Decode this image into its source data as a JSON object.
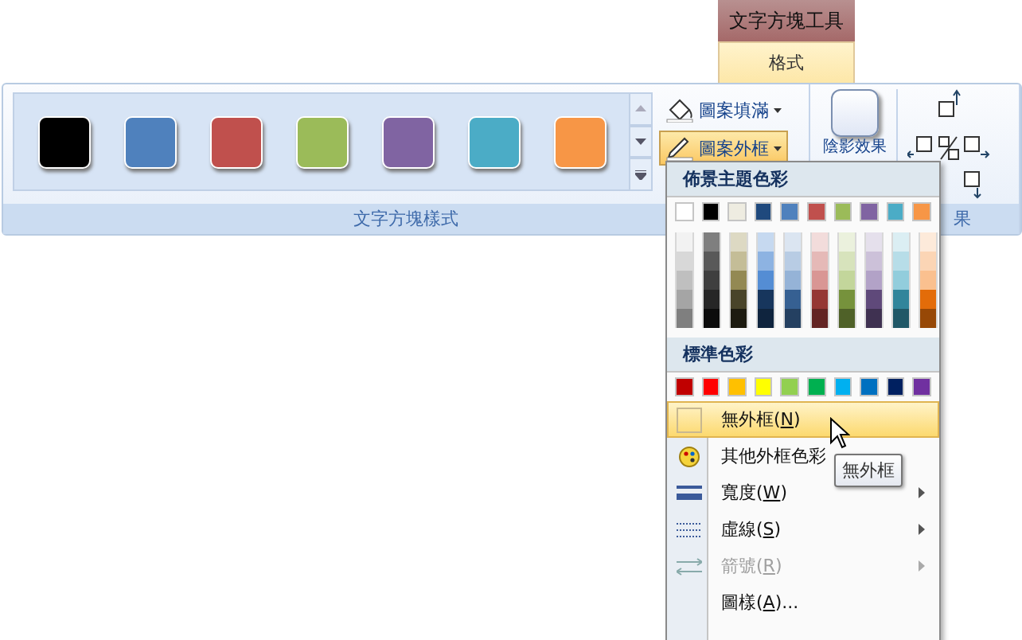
{
  "context_tab": {
    "title": "文字方塊工具",
    "tab": {
      "label": "格式",
      "selected": true
    }
  },
  "style_group": {
    "label": "文字方塊樣式",
    "swatches": [
      {
        "color": "#000000"
      },
      {
        "color": "#4f81bd"
      },
      {
        "color": "#c0504d"
      },
      {
        "color": "#9bbb59"
      },
      {
        "color": "#8064a2"
      },
      {
        "color": "#4bacc6"
      },
      {
        "color": "#f79646"
      }
    ],
    "fill_button": {
      "label": "圖案填滿"
    },
    "outline_button": {
      "label": "圖案外框",
      "expanded": true
    }
  },
  "shadow_group": {
    "button_label": "陰影效果",
    "group_label_visible": "果"
  },
  "outline_menu": {
    "theme_header": "佈景主題色彩",
    "theme_colors": [
      {
        "color": "#ffffff",
        "shades": [
          {
            "color": "#f2f2f2"
          },
          {
            "color": "#d8d8d8"
          },
          {
            "color": "#bfbfbf"
          },
          {
            "color": "#a5a5a5"
          },
          {
            "color": "#7f7f7f"
          }
        ]
      },
      {
        "color": "#000000",
        "shades": [
          {
            "color": "#7f7f7f"
          },
          {
            "color": "#595959"
          },
          {
            "color": "#3f3f3f"
          },
          {
            "color": "#262626"
          },
          {
            "color": "#0c0c0c"
          }
        ]
      },
      {
        "color": "#eeece1",
        "shades": [
          {
            "color": "#ddd9c3"
          },
          {
            "color": "#c4bd97"
          },
          {
            "color": "#938953"
          },
          {
            "color": "#494429"
          },
          {
            "color": "#1d1b10"
          }
        ]
      },
      {
        "color": "#1f497d",
        "shades": [
          {
            "color": "#c6d9f0"
          },
          {
            "color": "#8db3e2"
          },
          {
            "color": "#548dd4"
          },
          {
            "color": "#17365d"
          },
          {
            "color": "#0f243e"
          }
        ]
      },
      {
        "color": "#4f81bd",
        "shades": [
          {
            "color": "#dbe5f1"
          },
          {
            "color": "#b8cce4"
          },
          {
            "color": "#95b3d7"
          },
          {
            "color": "#366092"
          },
          {
            "color": "#244061"
          }
        ]
      },
      {
        "color": "#c0504d",
        "shades": [
          {
            "color": "#f2dcdb"
          },
          {
            "color": "#e5b9b7"
          },
          {
            "color": "#d99694"
          },
          {
            "color": "#953734"
          },
          {
            "color": "#632423"
          }
        ]
      },
      {
        "color": "#9bbb59",
        "shades": [
          {
            "color": "#ebf1dd"
          },
          {
            "color": "#d7e3bc"
          },
          {
            "color": "#c3d69b"
          },
          {
            "color": "#76923c"
          },
          {
            "color": "#4f6128"
          }
        ]
      },
      {
        "color": "#8064a2",
        "shades": [
          {
            "color": "#e5e0ec"
          },
          {
            "color": "#ccc1d9"
          },
          {
            "color": "#b2a2c7"
          },
          {
            "color": "#5f497a"
          },
          {
            "color": "#3f3151"
          }
        ]
      },
      {
        "color": "#4bacc6",
        "shades": [
          {
            "color": "#dbeef3"
          },
          {
            "color": "#b7dde8"
          },
          {
            "color": "#92cddc"
          },
          {
            "color": "#31859b"
          },
          {
            "color": "#205867"
          }
        ]
      },
      {
        "color": "#f79646",
        "shades": [
          {
            "color": "#fdeada"
          },
          {
            "color": "#fbd5b5"
          },
          {
            "color": "#fac08f"
          },
          {
            "color": "#e36c09"
          },
          {
            "color": "#974806"
          }
        ]
      }
    ],
    "standard_header": "標準色彩",
    "standard_colors": [
      {
        "color": "#c00000"
      },
      {
        "color": "#ff0000"
      },
      {
        "color": "#ffc000"
      },
      {
        "color": "#ffff00"
      },
      {
        "color": "#92d050"
      },
      {
        "color": "#00b050"
      },
      {
        "color": "#00b0f0"
      },
      {
        "color": "#0070c0"
      },
      {
        "color": "#002060"
      },
      {
        "color": "#7030a0"
      }
    ],
    "items": [
      {
        "kind": "none",
        "text": "無外框(",
        "accel": "N",
        "tail": ")",
        "selected": true,
        "disabled": false,
        "submenu": false
      },
      {
        "kind": "colors",
        "text": "其他外框色彩",
        "selected": false,
        "disabled": false,
        "submenu": false
      },
      {
        "kind": "weight",
        "text": "寬度(",
        "accel": "W",
        "tail": ")",
        "selected": false,
        "disabled": false,
        "submenu": true
      },
      {
        "kind": "dashes",
        "text": "虛線(",
        "accel": "S",
        "tail": ")",
        "selected": false,
        "disabled": false,
        "submenu": true
      },
      {
        "kind": "arrows",
        "text": "箭號(",
        "accel": "R",
        "tail": ")",
        "selected": false,
        "disabled": true,
        "submenu": true
      },
      {
        "kind": "pattern",
        "text": "圖樣(",
        "accel": "A",
        "tail": ")...",
        "selected": false,
        "disabled": false,
        "submenu": false
      }
    ]
  },
  "tooltip": {
    "text": "無外框"
  }
}
